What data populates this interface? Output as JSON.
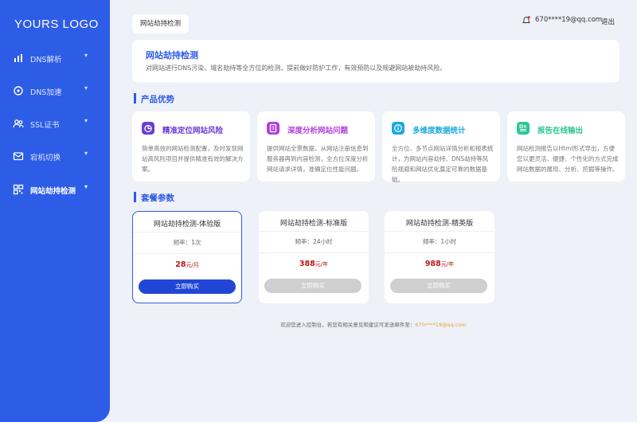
{
  "sidebar": {
    "logo": "YOURS LOGO",
    "items": [
      {
        "label": "DNS解析",
        "icon": "bar-chart-icon"
      },
      {
        "label": "DNS加速",
        "icon": "gauge-icon"
      },
      {
        "label": "SSL证书",
        "icon": "users-icon"
      },
      {
        "label": "宕机切换",
        "icon": "mail-icon"
      },
      {
        "label": "网站劫持检测",
        "icon": "qrcode-icon",
        "active": true
      }
    ]
  },
  "header": {
    "tab": "网站劫持检测",
    "user": "670****19@qq.com",
    "logout": "退出"
  },
  "intro": {
    "title": "网站劫持检测",
    "desc": "对网站进行DNS污染、域名劫持等全方位的检测，提前做好防护工作，有效预防以及规避网站被劫持风险。"
  },
  "features_title": "产品优势",
  "features": [
    {
      "title": "精准定位网站风险",
      "desc": "简单高效的网站检测配置，及时发现网站高风险项目并提供精准有效的解决方案。",
      "color": "#6a3bd6",
      "icon": "pie-chart-icon"
    },
    {
      "title": "深度分析网站问题",
      "desc": "提供网站全景数据，从网站注册信息到服务器再到内容检测，全方位深度分析网站请求详情，准确定位性能问题。",
      "color": "#b33ee0",
      "icon": "document-icon"
    },
    {
      "title": "多维度数据统计",
      "desc": "全方位、多节点网站详情分析和报表统计，为网站内容劫持、DNS劫持等风险规避和网站优化奠定可靠的数据基础。",
      "color": "#1aa8e0",
      "icon": "info-icon"
    },
    {
      "title": "报告在线输出",
      "desc": "网站检测报告以Html形式导出，方便您以更灵活、便捷、个性化的方式完成网站数据的展现、分析、挖掘等操作。",
      "color": "#2cc78f",
      "icon": "report-icon"
    }
  ],
  "plans_title": "套餐参数",
  "plans": [
    {
      "name": "网站劫持检测-体验版",
      "freq": "频率：1次",
      "price": "28",
      "unit": "元/月",
      "button": "立即购买",
      "active": true
    },
    {
      "name": "网站劫持检测-标准版",
      "freq": "频率：24小时",
      "price": "388",
      "unit": "元/年",
      "button": "立即购买",
      "active": false
    },
    {
      "name": "网站劫持检测-精英版",
      "freq": "频率：1小时",
      "price": "988",
      "unit": "元/年",
      "button": "立即购买",
      "active": false
    }
  ],
  "footer": {
    "text": "欢迎您进入控制台，若您有相关意见和建议可发送邮件至：",
    "email": "670****19@qq.com"
  },
  "colors": {
    "primary": "#2d5ce6",
    "price": "#c0151b",
    "background": "#eef1f7"
  }
}
